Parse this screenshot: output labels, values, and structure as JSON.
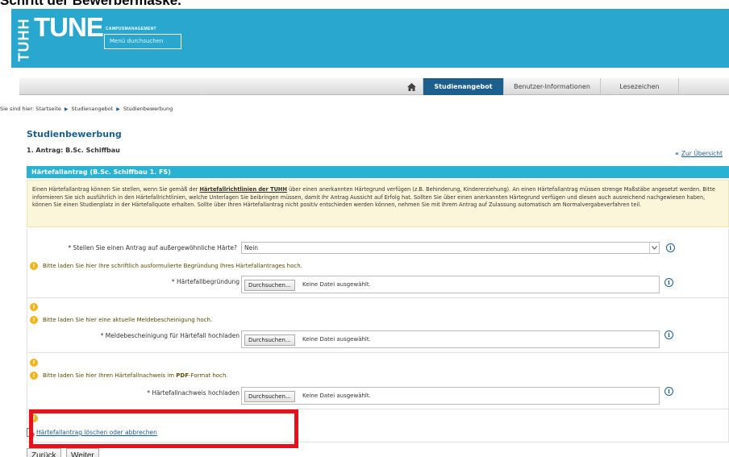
{
  "caption": "Schritt der Bewerbermaske.",
  "header": {
    "logo_vertical": "TUHH",
    "logo_main": "TUNE",
    "logo_sub": "CAMPUSMANAGEMENT",
    "search_placeholder": "Menü durchsuchen"
  },
  "nav": {
    "home_icon": "home-icon",
    "tabs": [
      {
        "label": "Studienangebot",
        "active": true
      },
      {
        "label": "Benutzer-Informationen",
        "active": false
      },
      {
        "label": "Lesezeichen",
        "active": false
      }
    ]
  },
  "breadcrumb": {
    "prefix": "Sie sind hier:",
    "items": [
      "Startseite",
      "Studienangebot",
      "Studienbewerbung"
    ]
  },
  "page": {
    "title": "Studienbewerbung",
    "subtitle": "1. Antrag: B.Sc. Schiffbau",
    "back_link": "Zur Übersicht"
  },
  "section": {
    "heading": "Härtefallantrag (B.Sc. Schiffbau 1. FS)",
    "info_pre": "Einen Härtefallantrag können Sie stellen, wenn Sie gemäß der ",
    "info_bold": "Härtefallrichtlinien der TUHH",
    "info_post": " über einen anerkannten Härtegrund verfügen (z.B. Behinderung, Kindererziehung). An einen Härtefallantrag müssen strenge Maßstäbe angesetzt werden. Bitte informieren Sie sich ausführlich in den Härtefallrichtlinien, welche Unterlagen Sie beibringen müssen, damit Ihr Antrag Aussicht auf Erfolg hat. Sollten Sie über einen anerkannten Härtegrund verfügen und diesen auch ausreichend nachgewiesen haben, können Sie einen Studienplatz in der Härtefallquote erhalten. Sollte über Ihren Härtefallantrag nicht positiv entschieden werden können, nehmen Sie mit Ihrem Antrag auf Zulassung automatisch am Normalvergabeverfahren teil."
  },
  "form": {
    "question_label": "* Stellen Sie einen Antrag auf außergewöhnliche Härte?",
    "question_value": "Nein",
    "warn1": "Bitte laden Sie hier Ihre schriftlich ausformulierte Begründung Ihres Härtefallantrages hoch.",
    "file1_label": "* Härtefallbegründung",
    "warn2": "Bitte laden Sie hier eine aktuelle Meldebescheinigung hoch.",
    "file2_label": "* Meldebescheinigung für Härtefall hochladen",
    "warn3_pre": "Bitte laden Sie hier Ihren Härtefallnachweis im ",
    "warn3_bold": "PDF",
    "warn3_post": "-Format hoch.",
    "file3_label": "* Härtefallnachweis hochladen",
    "browse_label": "Durchsuchen...",
    "no_file": "Keine Datei ausgewählt.",
    "delete_link": "Härtefallantrag löschen oder abbrechen"
  },
  "buttons": {
    "back": "Zurück",
    "next": "Weiter"
  },
  "colors": {
    "header_bg": "#2aa7cf",
    "accent": "#1d5f8c",
    "section_head": "#2ab2d2",
    "info_bg": "#fbf6d9",
    "warn": "#f3b41a",
    "highlight": "#e8101a"
  }
}
